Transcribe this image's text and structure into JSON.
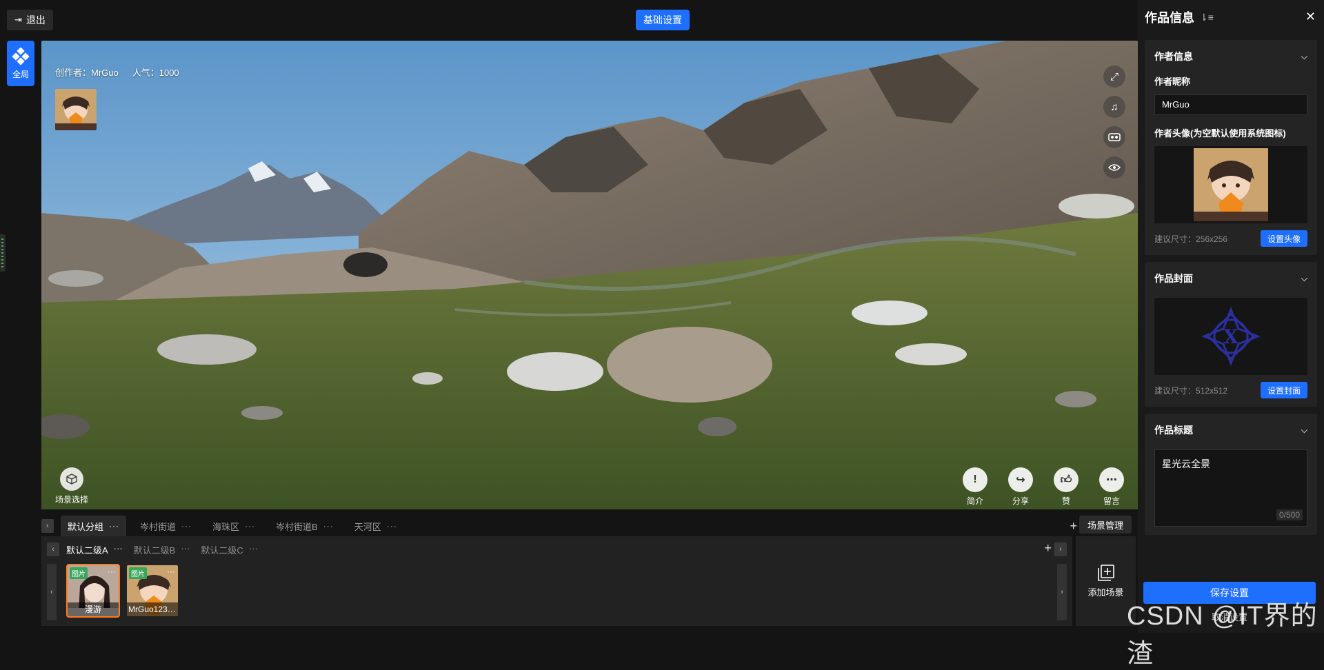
{
  "topbar": {
    "exit_label": "退出",
    "settings_label": "基础设置"
  },
  "global": {
    "label": "全局"
  },
  "viewer": {
    "creator_label": "创作者：MrGuo",
    "popularity_label": "人气：1000",
    "scene_select_label": "场景选择",
    "actions": [
      {
        "label": "简介",
        "icon": "info-icon"
      },
      {
        "label": "分享",
        "icon": "share-icon"
      },
      {
        "label": "赞",
        "icon": "thumbs-up-icon"
      },
      {
        "label": "留言",
        "icon": "comment-icon"
      }
    ],
    "tools": [
      "fullscreen-icon",
      "music-icon",
      "vr-glasses-icon",
      "eye-icon"
    ]
  },
  "groups": {
    "tabs": [
      "默认分组",
      "岑村街道",
      "海珠区",
      "岑村街道B",
      "天河区"
    ],
    "active_index": 0,
    "more_glyph": "···",
    "scene_manage_label": "场景管理"
  },
  "subgroups": {
    "tabs": [
      "默认二级A",
      "默认二级B",
      "默认二级C"
    ],
    "active_index": 0
  },
  "scenes": [
    {
      "tag": "图片",
      "caption": "漫游",
      "selected": true
    },
    {
      "tag": "图片",
      "caption": "MrGuo1231...",
      "selected": false
    }
  ],
  "add_scene_label": "添加场景",
  "panel": {
    "title": "作品信息",
    "author_section": {
      "title": "作者信息",
      "nickname_label": "作者昵称",
      "nickname_value": "MrGuo",
      "avatar_label": "作者头像(为空默认使用系统图标)",
      "size_hint": "建议尺寸：256x256",
      "set_button": "设置头像"
    },
    "cover_section": {
      "title": "作品封面",
      "size_hint": "建议尺寸：512x512",
      "set_button": "设置封面"
    },
    "title_section": {
      "title": "作品标题",
      "value": "星光云全景",
      "count": "0/500"
    },
    "save_label": "保存设置",
    "cancel_label": "取消设置"
  },
  "watermark": "CSDN @IT界的渣",
  "colors": {
    "accent": "#1f6fff",
    "selected_border": "#ff7a1a",
    "tag_green": "#3aa55d"
  }
}
